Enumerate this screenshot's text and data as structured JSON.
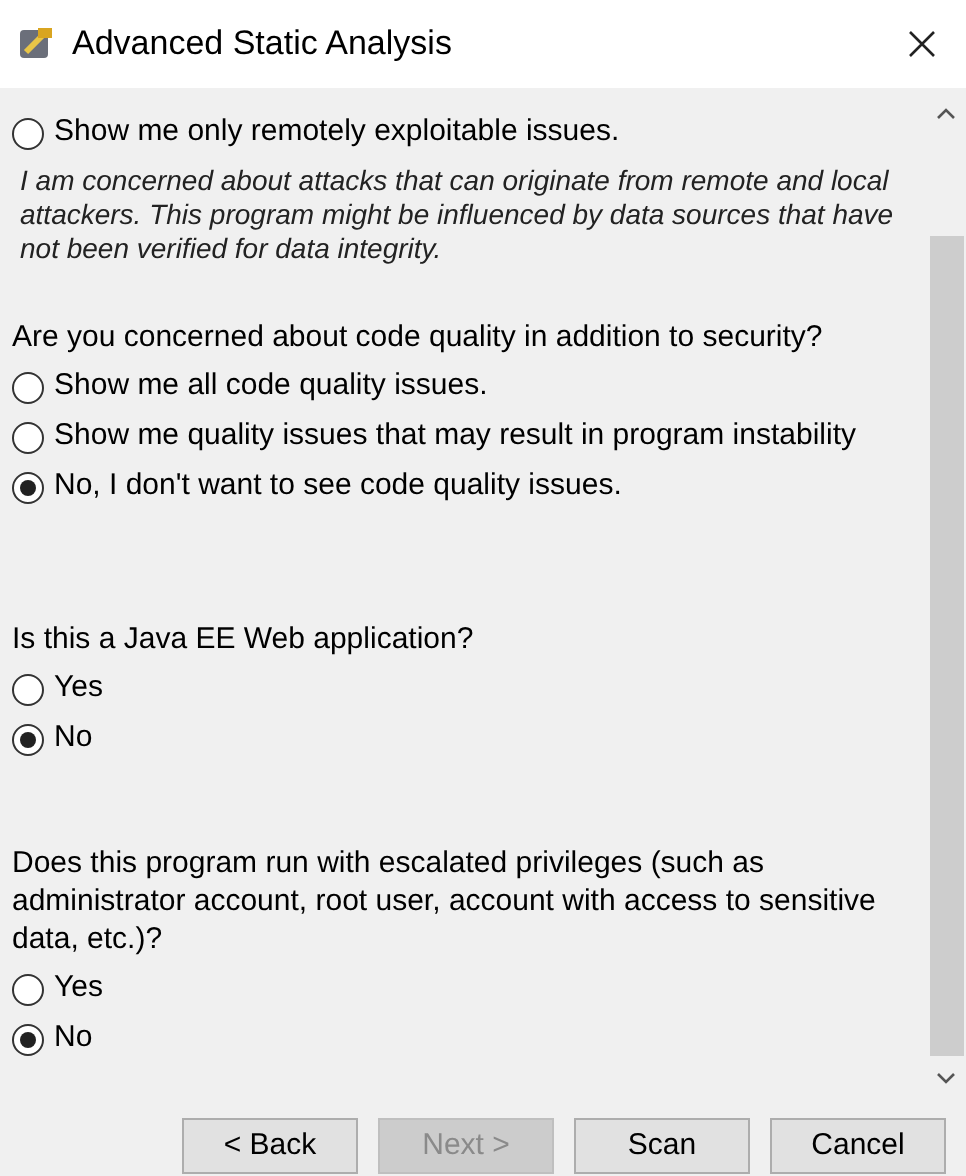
{
  "window": {
    "title": "Advanced Static Analysis"
  },
  "sections": [
    {
      "options": [
        {
          "label": "Show me only remotely exploitable issues.",
          "selected": false,
          "description": "I am concerned about attacks that can originate from remote and local attackers. This program might be influenced by data sources that have not been verified for data integrity."
        }
      ]
    },
    {
      "question": "Are you concerned about code quality in addition to security?",
      "options": [
        {
          "label": "Show me all code quality issues.",
          "selected": false
        },
        {
          "label": "Show me quality issues that may result in program instability",
          "selected": false
        },
        {
          "label": "No, I don't want to see code quality issues.",
          "selected": true
        }
      ]
    },
    {
      "question": "Is this a Java EE Web application?",
      "options": [
        {
          "label": "Yes",
          "selected": false
        },
        {
          "label": "No",
          "selected": true
        }
      ]
    },
    {
      "question": "Does this program run with escalated privileges (such as administrator account, root user, account with access to sensitive data, etc.)?",
      "options": [
        {
          "label": "Yes",
          "selected": false
        },
        {
          "label": "No",
          "selected": true
        }
      ]
    }
  ],
  "buttons": [
    {
      "label": "< Back",
      "disabled": false
    },
    {
      "label": "Next >",
      "disabled": true
    },
    {
      "label": "Scan",
      "disabled": false
    },
    {
      "label": "Cancel",
      "disabled": false
    }
  ]
}
